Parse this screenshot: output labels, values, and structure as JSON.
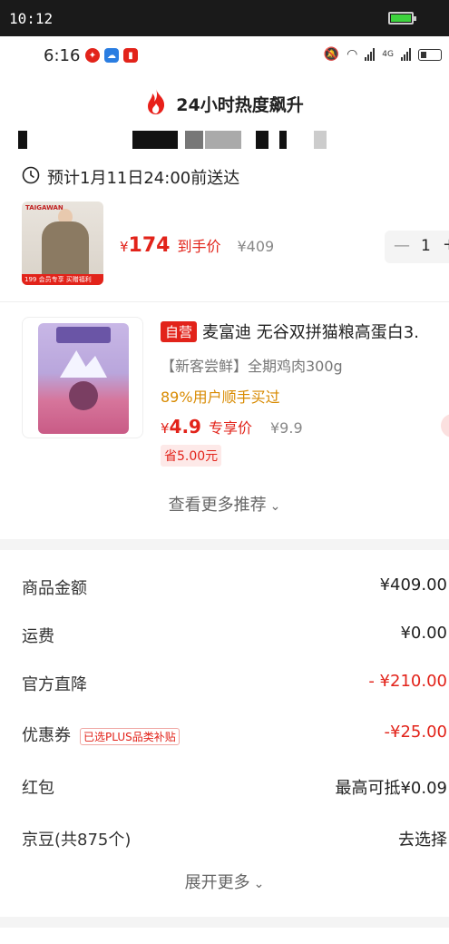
{
  "outer_status": {
    "time": "10:12"
  },
  "phone_status": {
    "time": "6:16",
    "network": "4G"
  },
  "hot_banner": {
    "text": "24小时热度飙升"
  },
  "delivery": {
    "text": "预计1月11日24:00前送达"
  },
  "cart_item": {
    "yen": "¥",
    "price": "174",
    "price_label": "到手价",
    "original_price": "¥409",
    "quantity": "1",
    "minus": "—",
    "plus": "+",
    "image_brand": "TAIGAWAN",
    "image_tag": "199 会员专享 买赠福利"
  },
  "recommendation": {
    "badge": "自营",
    "title": "麦富迪 无谷双拼猫粮高蛋白3.",
    "subtitle": "【新客尝鲜】全期鸡肉300g",
    "buyers": "89%用户顺手买过",
    "yen": "¥",
    "price": "4.9",
    "price_label": "专享价",
    "original_price": "¥9.9",
    "save": "省5.00元"
  },
  "more_recommendations": "查看更多推荐",
  "summary": {
    "goods_amount": {
      "label": "商品金额",
      "value": "¥409.00"
    },
    "shipping": {
      "label": "运费",
      "value": "¥0.00"
    },
    "official_discount": {
      "label": "官方直降",
      "value": "- ¥210.00"
    },
    "coupon": {
      "label": "优惠券",
      "tag": "已选PLUS品类补贴",
      "value": "-¥25.00"
    },
    "red_packet": {
      "label": "红包",
      "value": "最高可抵¥0.09"
    },
    "jd_beans": {
      "label": "京豆(共875个)",
      "value": "去选择"
    }
  },
  "expand_more": "展开更多",
  "colors": {
    "accent": "#e2231a",
    "orange": "#d88a00"
  }
}
